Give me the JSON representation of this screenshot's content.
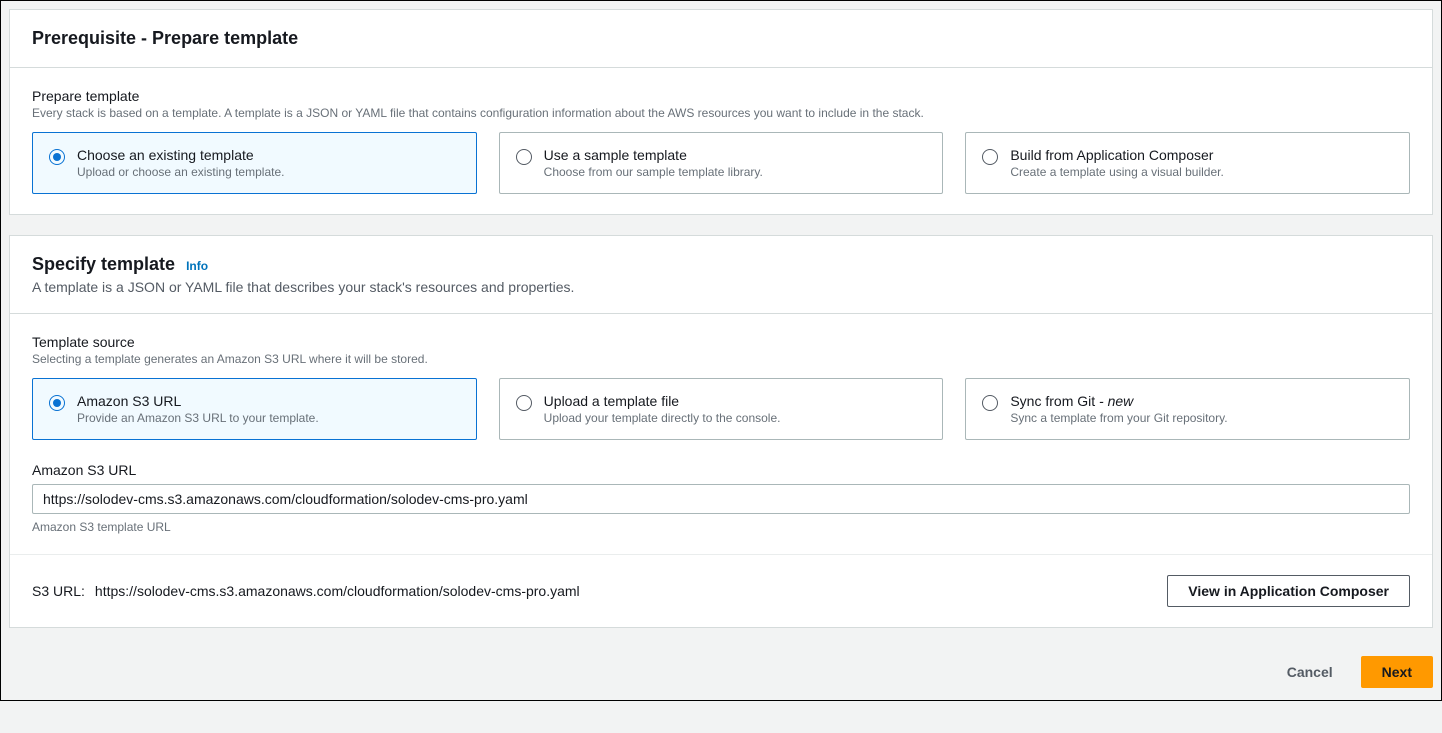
{
  "prereq": {
    "title": "Prerequisite - Prepare template",
    "section_label": "Prepare template",
    "section_hint": "Every stack is based on a template. A template is a JSON or YAML file that contains configuration information about the AWS resources you want to include in the stack.",
    "options": [
      {
        "title": "Choose an existing template",
        "subtitle": "Upload or choose an existing template."
      },
      {
        "title": "Use a sample template",
        "subtitle": "Choose from our sample template library."
      },
      {
        "title": "Build from Application Composer",
        "subtitle": "Create a template using a visual builder."
      }
    ]
  },
  "specify": {
    "title": "Specify template",
    "info_label": "Info",
    "description": "A template is a JSON or YAML file that describes your stack's resources and properties.",
    "source_label": "Template source",
    "source_hint": "Selecting a template generates an Amazon S3 URL where it will be stored.",
    "options": [
      {
        "title": "Amazon S3 URL",
        "subtitle": "Provide an Amazon S3 URL to your template."
      },
      {
        "title": "Upload a template file",
        "subtitle": "Upload your template directly to the console."
      },
      {
        "title": "Sync from Git",
        "new": "- new",
        "subtitle": "Sync a template from your Git repository."
      }
    ],
    "url_field_label": "Amazon S3 URL",
    "url_value": "https://solodev-cms.s3.amazonaws.com/cloudformation/solodev-cms-pro.yaml",
    "url_hint": "Amazon S3 template URL",
    "s3url_label": "S3 URL:",
    "s3url_value": "https://solodev-cms.s3.amazonaws.com/cloudformation/solodev-cms-pro.yaml",
    "view_composer_btn": "View in Application Composer"
  },
  "actions": {
    "cancel": "Cancel",
    "next": "Next"
  }
}
